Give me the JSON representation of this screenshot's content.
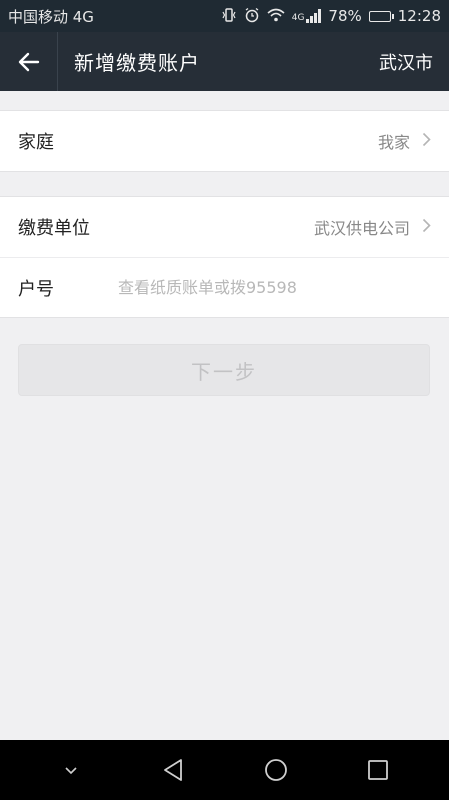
{
  "status": {
    "carrier": "中国移动 4G",
    "net_badge": "4G",
    "battery_pct": "78%",
    "battery_level": 0.78,
    "time": "12:28"
  },
  "nav": {
    "title": "新增缴费账户",
    "city": "武汉市"
  },
  "account_group": {
    "label": "家庭",
    "value": "我家"
  },
  "form": {
    "unit_label": "缴费单位",
    "unit_value": "武汉供电公司",
    "account_label": "户号",
    "account_placeholder": "查看纸质账单或拨95598",
    "account_value": ""
  },
  "next_button_label": "下一步"
}
